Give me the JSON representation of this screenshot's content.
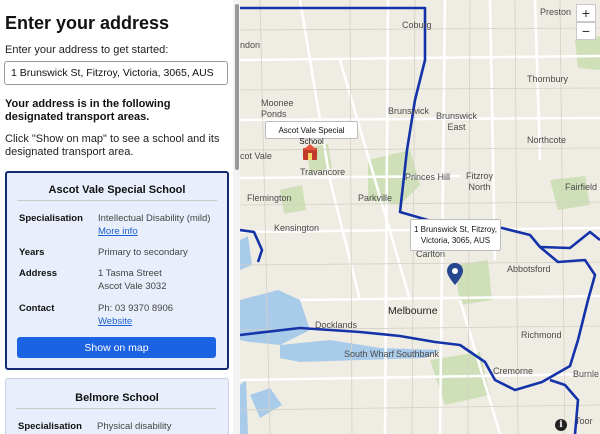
{
  "panel": {
    "title": "Enter your address",
    "intro": "Enter your address to get started:",
    "address_value": "1 Brunswick St, Fitzroy, Victoria, 3065, AUS",
    "result_heading": "Your address is in the following designated transport areas.",
    "hint": "Click \"Show on map\" to see a school and its designated transport area."
  },
  "schools": [
    {
      "name": "Ascot Vale Special School",
      "specialisation_label": "Specialisation",
      "specialisation": "Intellectual Disability (mild)",
      "more_info": "More info",
      "years_label": "Years",
      "years": "Primary to secondary",
      "address_label": "Address",
      "address_line1": "1 Tasma Street",
      "address_line2": "Ascot Vale 3032",
      "contact_label": "Contact",
      "phone": "Ph: 03 9370 8906",
      "website": "Website",
      "show_on_map": "Show on map"
    },
    {
      "name": "Belmore School",
      "specialisation_label": "Specialisation",
      "specialisation": "Physical disability"
    }
  ],
  "map": {
    "zoom_in": "+",
    "zoom_out": "−",
    "info": "i",
    "tooltip_school": "Ascot Vale Special School",
    "tooltip_address_line1": "1 Brunswick St, Fitzroy,",
    "tooltip_address_line2": "Victoria, 3065, AUS",
    "colors": {
      "boundary": "#1433a8",
      "pin": "#26468f",
      "park": "#cfe0b8",
      "water": "#a9cbea",
      "land": "#efece4"
    },
    "labels": {
      "coburg": "Coburg",
      "preston": "Preston",
      "don": "ndon",
      "thornbury": "Thornbury",
      "moonee_ponds": "Moonee\nPonds",
      "brunswick": "Brunswick",
      "brunswick_east": "Brunswick\nEast",
      "northcote": "Northcote",
      "ascot_vale": "cot Vale",
      "travancore": "Travancore",
      "parkville": "Parkville",
      "princes_hill": "Princes Hill",
      "fitzroy_north": "Fitzroy\nNorth",
      "fairfield": "Fairfield",
      "flemington": "Flemington",
      "kensington": "Kensington",
      "carlton": "Carlton",
      "abbotsford": "Abbotsford",
      "docklands": "Docklands",
      "melbourne": "Melbourne",
      "richmond": "Richmond",
      "south_wharf": "South Wharf",
      "southbank": "Southbank",
      "cremorne": "Cremorne",
      "burnley": "Burnle",
      "toorak": "Toor"
    }
  }
}
